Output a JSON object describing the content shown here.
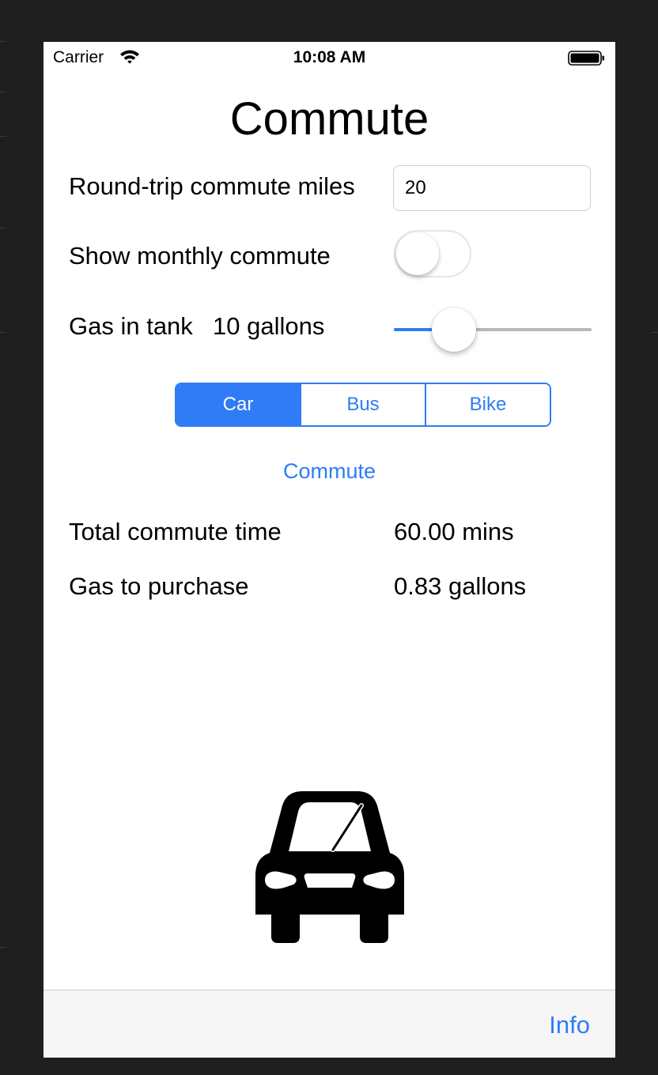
{
  "status_bar": {
    "carrier": "Carrier",
    "time": "10:08 AM"
  },
  "title": "Commute",
  "miles": {
    "label": "Round-trip commute miles",
    "value": "20"
  },
  "monthly": {
    "label": "Show monthly commute",
    "on": false
  },
  "gas_tank": {
    "label": "Gas in tank",
    "value_text": "10 gallons",
    "slider_fraction": 0.3
  },
  "segments": [
    {
      "label": "Car",
      "selected": true
    },
    {
      "label": "Bus",
      "selected": false
    },
    {
      "label": "Bike",
      "selected": false
    }
  ],
  "commute_button": "Commute",
  "results": {
    "time_label": "Total commute time",
    "time_value": "60.00 mins",
    "gas_label": "Gas to purchase",
    "gas_value": "0.83 gallons"
  },
  "vehicle_icon": "car-icon",
  "toolbar": {
    "info": "Info"
  },
  "colors": {
    "accent": "#2f7cf6",
    "background": "#ffffff",
    "frame": "#1f1f1f"
  }
}
